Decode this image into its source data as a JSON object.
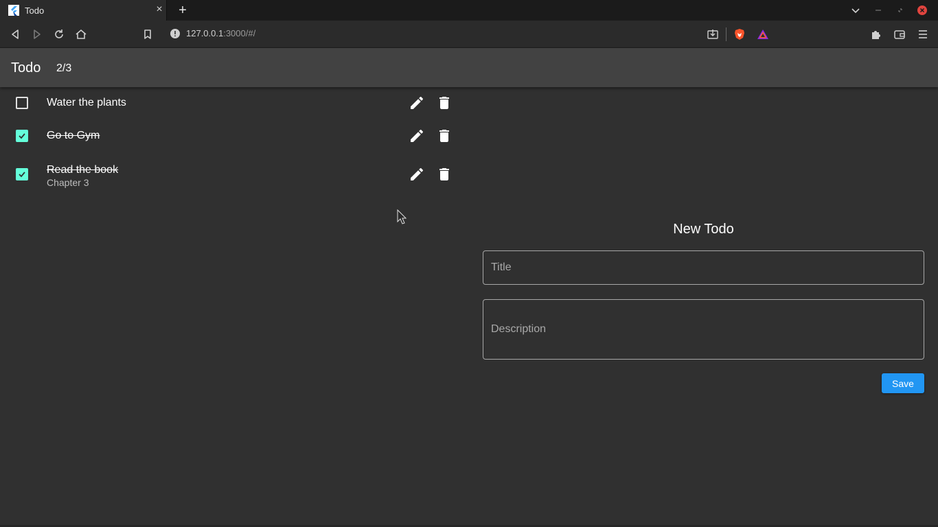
{
  "browser": {
    "tab_title": "Todo",
    "url_host": "127.0.0.1",
    "url_rest": ":3000/#/"
  },
  "app": {
    "title": "Todo",
    "count": "2/3"
  },
  "todos": [
    {
      "title": "Water the plants",
      "description": "",
      "done": false
    },
    {
      "title": "Go to Gym",
      "description": "",
      "done": true
    },
    {
      "title": "Read the book",
      "description": "Chapter 3",
      "done": true
    }
  ],
  "form": {
    "heading": "New Todo",
    "title_placeholder": "Title",
    "description_placeholder": "Description",
    "save_label": "Save"
  },
  "colors": {
    "check_accent": "#64ffda",
    "button_primary": "#2196f3",
    "appbar": "#424242",
    "background": "#303030"
  }
}
